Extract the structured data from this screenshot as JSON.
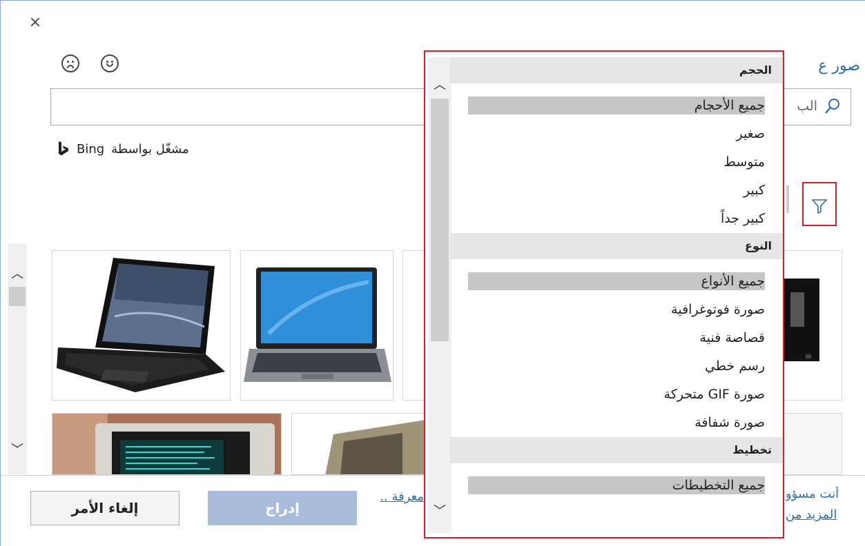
{
  "dialog": {
    "close_label": "×",
    "title_partial": "صور ع",
    "search_placeholder_partial": "الب",
    "powered_by_label": "مشغّل بواسطة",
    "brand": "Bing"
  },
  "feedback": {
    "sad_icon": "frown-face-icon",
    "happy_icon": "smile-face-icon"
  },
  "filter": {
    "icon": "funnel-filter-icon"
  },
  "dropdown": {
    "sections": [
      {
        "header": "الحجم",
        "items": [
          {
            "label": "جميع الأحجام",
            "selected": true
          },
          {
            "label": "صغير",
            "selected": false
          },
          {
            "label": "متوسط",
            "selected": false
          },
          {
            "label": "كبير",
            "selected": false
          },
          {
            "label": "كبير جداً",
            "selected": false
          }
        ]
      },
      {
        "header": "النوع",
        "items": [
          {
            "label": "جميع الأنواع",
            "selected": true
          },
          {
            "label": "صورة فوتوغرافية",
            "selected": false
          },
          {
            "label": "قصاصة فنية",
            "selected": false
          },
          {
            "label": "رسم خطي",
            "selected": false
          },
          {
            "label": "صورة GIF متحركة",
            "selected": false
          },
          {
            "label": "صورة شفافة",
            "selected": false
          }
        ]
      },
      {
        "header": "تخطيط",
        "items": [
          {
            "label": "جميع التخطيطات",
            "selected": true
          }
        ]
      }
    ]
  },
  "footer": {
    "cancel_label": "إلغاء الأمر",
    "insert_label": "إدراج",
    "learn_more_partial": "معرفة ..",
    "responsibility_line1": "أنت مسؤو",
    "responsibility_line2": "المزيد من"
  },
  "colors": {
    "accent_red": "#e01a22",
    "link_blue": "#2b6cb0",
    "insert_disabled": "#a9bcdc"
  }
}
